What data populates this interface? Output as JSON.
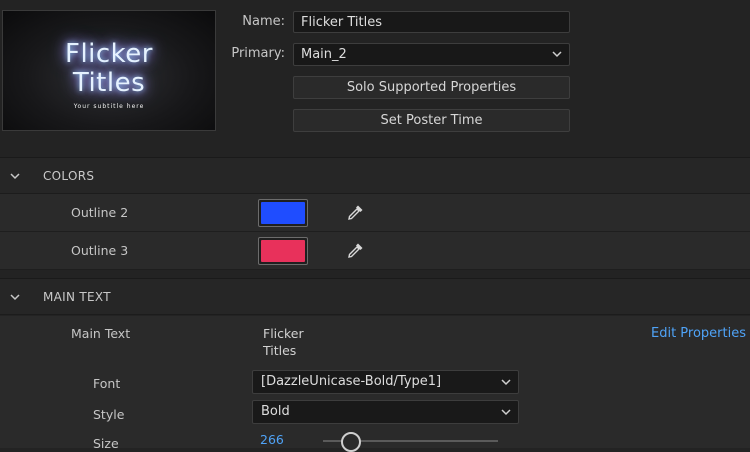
{
  "preview": {
    "line1": "Flicker",
    "line2": "Titles",
    "subtitle": "Your subtitle here"
  },
  "header": {
    "name_label": "Name:",
    "name_value": "Flicker Titles",
    "primary_label": "Primary:",
    "primary_value": "Main_2",
    "solo_button": "Solo Supported Properties",
    "poster_button": "Set Poster Time"
  },
  "colors_section": {
    "title": "COLORS",
    "items": [
      {
        "label": "Outline 2",
        "color": "#1f4dff"
      },
      {
        "label": "Outline 3",
        "color": "#e8315b"
      }
    ]
  },
  "main_text_section": {
    "title": "MAIN TEXT",
    "label": "Main Text",
    "value_line1": "Flicker",
    "value_line2": "Titles",
    "edit_link": "Edit Properties",
    "font_label": "Font",
    "font_value": "[DazzleUnicase-Bold/Type1]",
    "style_label": "Style",
    "style_value": "Bold",
    "size_label": "Size",
    "size_value": "266",
    "size_fraction": 0.16
  },
  "colors": {
    "accent_link": "#4fa3f7"
  }
}
